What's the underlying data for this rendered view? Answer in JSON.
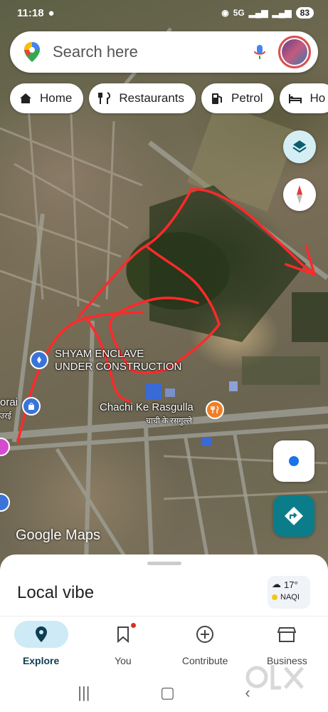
{
  "status": {
    "time": "11:18",
    "battery": "83",
    "network": "5G"
  },
  "search": {
    "placeholder": "Search here"
  },
  "chips": [
    {
      "icon": "home-icon",
      "label": "Home"
    },
    {
      "icon": "restaurant-icon",
      "label": "Restaurants"
    },
    {
      "icon": "fuel-icon",
      "label": "Petrol"
    },
    {
      "icon": "hotel-icon",
      "label": "Ho"
    }
  ],
  "map_labels": {
    "shyam_line1": "SHYAM ENCLAVE",
    "shyam_line2": "UNDER CONSTRUCTION",
    "chachi_en": "Chachi Ke Rasgulla",
    "chachi_hi": "चाची के रसगुल्ले",
    "left_en": "orai",
    "left_hi": "उरई",
    "watermark": "Google Maps"
  },
  "sheet": {
    "title": "Local vibe"
  },
  "weather": {
    "temp": "17°",
    "aqi": "NAQI"
  },
  "nav": [
    {
      "label": "Explore",
      "icon": "pin-icon",
      "active": true
    },
    {
      "label": "You",
      "icon": "bookmark-icon",
      "active": false
    },
    {
      "label": "Contribute",
      "icon": "add-circle-icon",
      "active": false
    },
    {
      "label": "Business",
      "icon": "storefront-icon",
      "active": false
    }
  ],
  "colors": {
    "accent": "#0b7d8a",
    "annotation": "#ff2a2a",
    "active_nav": "#cdeaf6"
  }
}
